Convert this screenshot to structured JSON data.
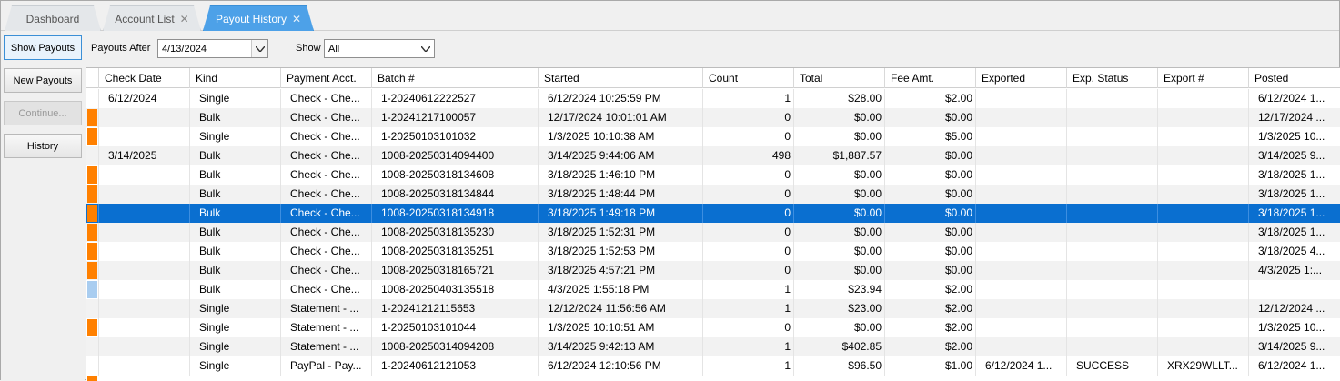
{
  "tabs": [
    {
      "label": "Dashboard",
      "closable": false,
      "active": false
    },
    {
      "label": "Account List",
      "closable": true,
      "active": false
    },
    {
      "label": "Payout History",
      "closable": true,
      "active": true
    }
  ],
  "sidebar": {
    "show_payouts": "Show Payouts",
    "new_payouts": "New Payouts",
    "continue": "Continue...",
    "history": "History"
  },
  "filters": {
    "payouts_after_label": "Payouts After",
    "payouts_after_value": "4/13/2024",
    "show_label": "Show",
    "show_value": "All"
  },
  "colors": {
    "orange_marker": "#ff8000",
    "blue_marker": "#a9cdf0",
    "selected_row": "#0a6fd0",
    "active_tab": "#4da1e8"
  },
  "grid": {
    "columns": [
      "Check Date",
      "Kind",
      "Payment Acct.",
      "Batch #",
      "Started",
      "Count",
      "Total",
      "Fee Amt.",
      "Exported",
      "Exp. Status",
      "Export #",
      "Posted"
    ],
    "rows": [
      {
        "marker": "",
        "check_date": "6/12/2024",
        "kind": "Single",
        "acct": "Check - Che...",
        "batch": "1-20240612222527",
        "started": "6/12/2024 10:25:59 PM",
        "count": "1",
        "total": "$28.00",
        "fee": "$2.00",
        "exported": "",
        "exp_status": "",
        "export_no": "",
        "posted": "6/12/2024 1..."
      },
      {
        "marker": "orange",
        "check_date": "",
        "kind": "Bulk",
        "acct": "Check - Che...",
        "batch": "1-20241217100057",
        "started": "12/17/2024 10:01:01 AM",
        "count": "0",
        "total": "$0.00",
        "fee": "$0.00",
        "exported": "",
        "exp_status": "",
        "export_no": "",
        "posted": "12/17/2024 ..."
      },
      {
        "marker": "orange",
        "check_date": "",
        "kind": "Single",
        "acct": "Check - Che...",
        "batch": "1-20250103101032",
        "started": "1/3/2025 10:10:38 AM",
        "count": "0",
        "total": "$0.00",
        "fee": "$5.00",
        "exported": "",
        "exp_status": "",
        "export_no": "",
        "posted": "1/3/2025 10..."
      },
      {
        "marker": "",
        "check_date": "3/14/2025",
        "kind": "Bulk",
        "acct": "Check - Che...",
        "batch": "1008-20250314094400",
        "started": "3/14/2025 9:44:06 AM",
        "count": "498",
        "total": "$1,887.57",
        "fee": "$0.00",
        "exported": "",
        "exp_status": "",
        "export_no": "",
        "posted": "3/14/2025 9..."
      },
      {
        "marker": "orange",
        "check_date": "",
        "kind": "Bulk",
        "acct": "Check - Che...",
        "batch": "1008-20250318134608",
        "started": "3/18/2025 1:46:10 PM",
        "count": "0",
        "total": "$0.00",
        "fee": "$0.00",
        "exported": "",
        "exp_status": "",
        "export_no": "",
        "posted": "3/18/2025 1..."
      },
      {
        "marker": "orange",
        "check_date": "",
        "kind": "Bulk",
        "acct": "Check - Che...",
        "batch": "1008-20250318134844",
        "started": "3/18/2025 1:48:44 PM",
        "count": "0",
        "total": "$0.00",
        "fee": "$0.00",
        "exported": "",
        "exp_status": "",
        "export_no": "",
        "posted": "3/18/2025 1..."
      },
      {
        "marker": "orange",
        "selected": true,
        "check_date": "",
        "kind": "Bulk",
        "acct": "Check - Che...",
        "batch": "1008-20250318134918",
        "started": "3/18/2025 1:49:18 PM",
        "count": "0",
        "total": "$0.00",
        "fee": "$0.00",
        "exported": "",
        "exp_status": "",
        "export_no": "",
        "posted": "3/18/2025 1..."
      },
      {
        "marker": "orange",
        "check_date": "",
        "kind": "Bulk",
        "acct": "Check - Che...",
        "batch": "1008-20250318135230",
        "started": "3/18/2025 1:52:31 PM",
        "count": "0",
        "total": "$0.00",
        "fee": "$0.00",
        "exported": "",
        "exp_status": "",
        "export_no": "",
        "posted": "3/18/2025 1..."
      },
      {
        "marker": "orange",
        "check_date": "",
        "kind": "Bulk",
        "acct": "Check - Che...",
        "batch": "1008-20250318135251",
        "started": "3/18/2025 1:52:53 PM",
        "count": "0",
        "total": "$0.00",
        "fee": "$0.00",
        "exported": "",
        "exp_status": "",
        "export_no": "",
        "posted": "3/18/2025 4..."
      },
      {
        "marker": "orange",
        "check_date": "",
        "kind": "Bulk",
        "acct": "Check - Che...",
        "batch": "1008-20250318165721",
        "started": "3/18/2025 4:57:21 PM",
        "count": "0",
        "total": "$0.00",
        "fee": "$0.00",
        "exported": "",
        "exp_status": "",
        "export_no": "",
        "posted": "4/3/2025 1:..."
      },
      {
        "marker": "blue",
        "check_date": "",
        "kind": "Bulk",
        "acct": "Check - Che...",
        "batch": "1008-20250403135518",
        "started": "4/3/2025 1:55:18 PM",
        "count": "1",
        "total": "$23.94",
        "fee": "$2.00",
        "exported": "",
        "exp_status": "",
        "export_no": "",
        "posted": ""
      },
      {
        "marker": "",
        "check_date": "",
        "kind": "Single",
        "acct": "Statement - ...",
        "batch": "1-20241212115653",
        "started": "12/12/2024 11:56:56 AM",
        "count": "1",
        "total": "$23.00",
        "fee": "$2.00",
        "exported": "",
        "exp_status": "",
        "export_no": "",
        "posted": "12/12/2024 ..."
      },
      {
        "marker": "orange",
        "check_date": "",
        "kind": "Single",
        "acct": "Statement - ...",
        "batch": "1-20250103101044",
        "started": "1/3/2025 10:10:51 AM",
        "count": "0",
        "total": "$0.00",
        "fee": "$2.00",
        "exported": "",
        "exp_status": "",
        "export_no": "",
        "posted": "1/3/2025 10..."
      },
      {
        "marker": "",
        "check_date": "",
        "kind": "Single",
        "acct": "Statement - ...",
        "batch": "1008-20250314094208",
        "started": "3/14/2025 9:42:13 AM",
        "count": "1",
        "total": "$402.85",
        "fee": "$2.00",
        "exported": "",
        "exp_status": "",
        "export_no": "",
        "posted": "3/14/2025 9..."
      },
      {
        "marker": "",
        "check_date": "",
        "kind": "Single",
        "acct": "PayPal - Pay...",
        "batch": "1-20240612121053",
        "started": "6/12/2024 12:10:56 PM",
        "count": "1",
        "total": "$96.50",
        "fee": "$1.00",
        "exported": "6/12/2024 1...",
        "exp_status": "SUCCESS",
        "export_no": "XRX29WLLT...",
        "posted": "6/12/2024 1..."
      }
    ]
  }
}
